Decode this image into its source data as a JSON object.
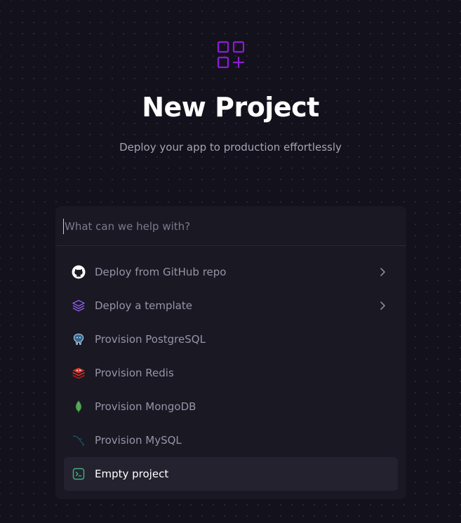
{
  "header": {
    "title": "New Project",
    "subtitle": "Deploy your app to production effortlessly",
    "logo_icon": "grid-plus-icon"
  },
  "search": {
    "placeholder": "What can we help with?",
    "value": ""
  },
  "menu": {
    "items": [
      {
        "label": "Deploy from GitHub repo",
        "icon": "github-icon",
        "has_submenu": true
      },
      {
        "label": "Deploy a template",
        "icon": "layers-icon",
        "has_submenu": true
      },
      {
        "label": "Provision PostgreSQL",
        "icon": "postgresql-icon",
        "has_submenu": false
      },
      {
        "label": "Provision Redis",
        "icon": "redis-icon",
        "has_submenu": false
      },
      {
        "label": "Provision MongoDB",
        "icon": "mongodb-icon",
        "has_submenu": false
      },
      {
        "label": "Provision MySQL",
        "icon": "mysql-icon",
        "has_submenu": false
      },
      {
        "label": "Empty project",
        "icon": "terminal-icon",
        "has_submenu": false,
        "selected": true
      }
    ]
  },
  "colors": {
    "background": "#13111c",
    "panel": "#191823",
    "accent": "#8e1bd6",
    "selected_row": "#24222f",
    "muted_text": "#9794a6"
  }
}
